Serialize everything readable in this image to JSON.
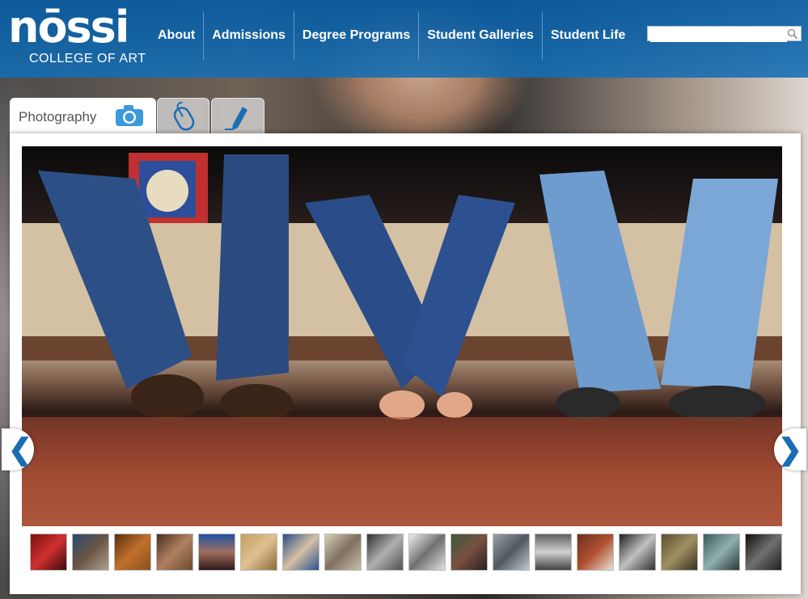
{
  "logo": {
    "word": "nōssi",
    "tagline": "COLLEGE OF ART"
  },
  "nav": [
    "About",
    "Admissions",
    "Degree Programs",
    "Student Galleries",
    "Student Life"
  ],
  "search": {
    "placeholder": "",
    "value": ""
  },
  "tabs": [
    {
      "label": "Photography",
      "icon": "camera-icon",
      "active": true
    },
    {
      "label": "",
      "icon": "mouse-icon",
      "active": false
    },
    {
      "label": "",
      "icon": "pen-icon",
      "active": false
    }
  ],
  "gallery": {
    "prev_icon": "chevron-left-icon",
    "next_icon": "chevron-right-icon",
    "thumbnail_count": 18
  },
  "colors": {
    "header_blue": "#0b5fa8",
    "accent_blue": "#1a6db3",
    "nav_text": "#ffffff"
  }
}
